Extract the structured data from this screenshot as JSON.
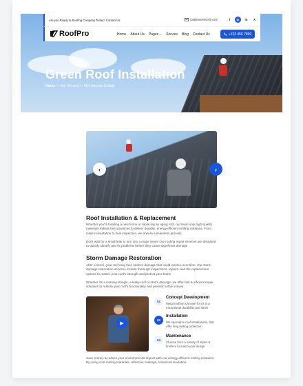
{
  "topbar": {
    "ready_text": "Are you Ready to Roofing Company Today?",
    "contact_link": "Contact Us",
    "email": "roofproservice@.com",
    "social": [
      "f",
      "◎",
      "in",
      "X"
    ]
  },
  "nav": {
    "logo_text": "RoofPro",
    "menu": [
      "Home",
      "About Us",
      "Pages",
      "Service",
      "Blog",
      "Contact Us"
    ],
    "pages_caret": "⌵",
    "phone": "+123 456 7890"
  },
  "hero": {
    "title": "Green Roof Installation",
    "crumbs": [
      "Home",
      "Our Service",
      "Our Service Details"
    ],
    "separator": ">"
  },
  "slider": {
    "prev": "‹",
    "next": "›"
  },
  "section1": {
    "title": "Roof Installation & Replacement",
    "p1": "Whether you're building a new home or replacing an aging roof, our team only high-quality materials follows best practices to deliver durable, energy-efficient roofing solutions. From initial consultation to final inspection, we ensure a seamless process.",
    "p2": "Don't wait for a small leak to turn into a major issue! Our roofing repair services are designed to quickly identify and fix problems before they cause significant damage"
  },
  "section2": {
    "title": "Storm Damage Restoration",
    "p1": "After a storm, your roof may face unseen damage that could worsen over time. Our storm damage restoration services include thorough inspections, repairs, and the replacement options to restore your roof's strength and protect your home.",
    "p2": "Whether it's a missing shingle, a leaky roof or storm damage, we offer fast & efficient repair solutions to restore your roof's functionality and prevent further issues"
  },
  "video": {
    "play_icon": "▶"
  },
  "features": [
    {
      "num": "01",
      "title": "Concept Development",
      "desc": "Metal roofing is known for its is a exceptional durability and sleek",
      "active": false
    },
    {
      "num": "02",
      "title": "Installation",
      "desc": "We specialize roof installations, that offer long lasting protection",
      "active": true
    },
    {
      "num": "03",
      "title": "Maintenance",
      "desc": "Choose from a variety of styles & finishes to match your design",
      "active": false
    }
  ],
  "footer_text": "Save money & reduce your environmental impact with our energy-efficient roofing solutions. By using cool roofing materials, reflective coatings, enhanced insulation,",
  "colors": {
    "accent": "#1a56db",
    "text": "#111111",
    "muted": "#555555"
  }
}
